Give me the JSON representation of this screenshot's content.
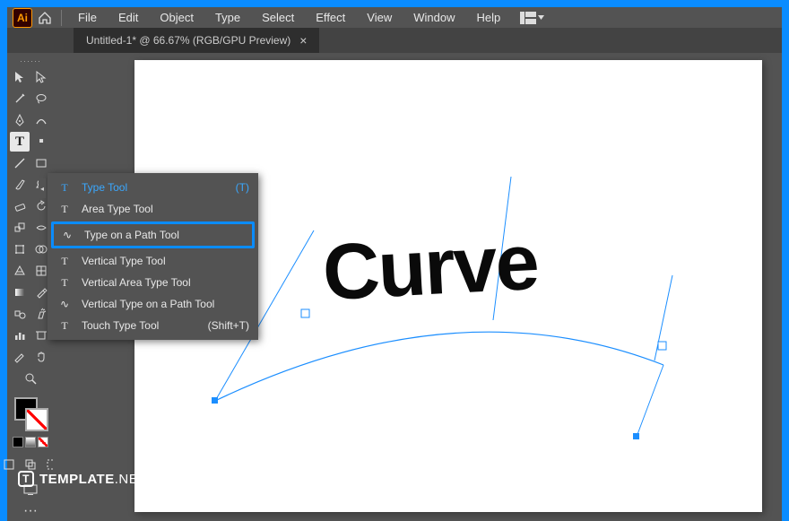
{
  "app": {
    "badge": "Ai"
  },
  "menubar": [
    "File",
    "Edit",
    "Object",
    "Type",
    "Select",
    "Effect",
    "View",
    "Window",
    "Help"
  ],
  "tab": {
    "label": "Untitled-1* @ 66.67% (RGB/GPU Preview)",
    "close": "×"
  },
  "toolbox": {
    "header": "······"
  },
  "flyout": {
    "items": [
      {
        "icon": "T",
        "label": "Type Tool",
        "kbd": "(T)",
        "selected": true
      },
      {
        "icon": "T",
        "label": "Area Type Tool"
      },
      {
        "icon": "∿",
        "label": "Type on a Path Tool",
        "highlight": true
      },
      {
        "icon": "T",
        "label": "Vertical Type Tool"
      },
      {
        "icon": "T",
        "label": "Vertical Area Type Tool"
      },
      {
        "icon": "∿",
        "label": "Vertical Type on a Path Tool"
      },
      {
        "icon": "T",
        "label": "Touch Type Tool",
        "kbd": "(Shift+T)"
      }
    ]
  },
  "canvas": {
    "text": "Curve"
  },
  "watermark": {
    "brand": "TEMPLATE",
    "suffix": ".NET"
  }
}
